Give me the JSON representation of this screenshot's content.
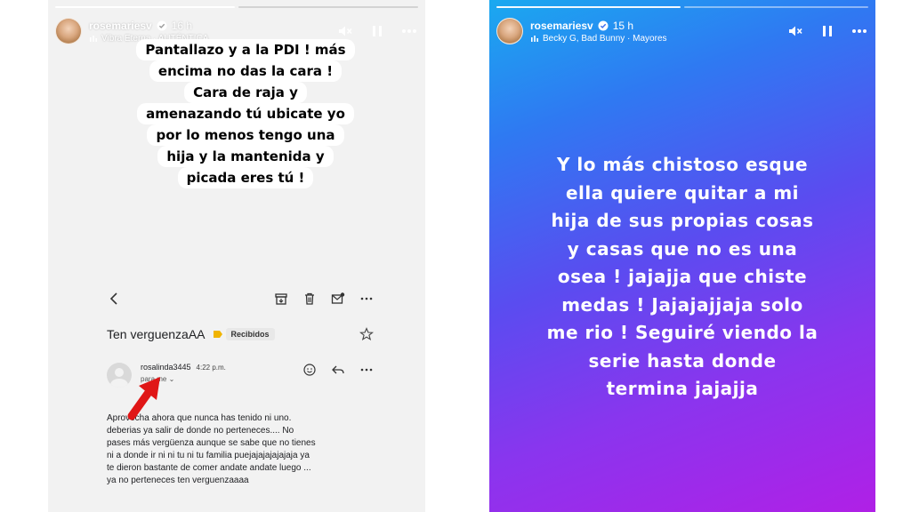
{
  "left_story": {
    "progress": {
      "segments": 2,
      "completed": 1
    },
    "username": "rosemariesv",
    "time": "16 h",
    "music": "Vibra Eterna · AUTÉNTICA",
    "caption_lines": [
      "Pantallazo y a la PDI ! más",
      "encima no das la cara !",
      "Cara de raja y",
      "amenazando tú ubicate yo",
      "por lo menos tengo una",
      "hija y la mantenida y",
      "picada eres tú !"
    ],
    "email": {
      "subject": "Ten verguenzaAA",
      "label": "Recibidos",
      "sender": "rosalinda3445",
      "sent_time": "4:22 p.m.",
      "recipient": "para me",
      "body_lines": [
        "Aprovecha ahora que nunca has tenido ni uno.",
        "deberias ya salir de donde no perteneces.... No",
        "pases más vergüenza aunque se sabe que no tienes",
        "ni a donde ir ni ni tu ni tu familia puejajajajajajaja ya",
        "te dieron bastante de comer andate andate luego ...",
        "ya no perteneces ten verguenzaaaa"
      ]
    }
  },
  "right_story": {
    "progress": {
      "segments": 2,
      "completed": 1
    },
    "username": "rosemariesv",
    "time": "15 h",
    "music": "Becky G, Bad Bunny · Mayores",
    "caption_lines": [
      "Y lo más chistoso esque",
      "ella quiere quitar a mi",
      "hija de sus propias cosas",
      "y casas que no es una",
      "osea !  jajajja que chiste",
      "medas ! Jajajajjaja solo",
      "me rio ! Seguiré viendo la",
      "serie hasta donde",
      "termina jajajja"
    ]
  },
  "colors": {
    "left_bg": "#f2f2f2",
    "right_gradient": [
      "#1aa9f0",
      "#5a4cf0",
      "#b020e6"
    ],
    "arrow": "#e01616",
    "verified": "#3897f0"
  },
  "icons": [
    "verified-badge-icon",
    "music-bars-icon",
    "mute-icon",
    "pause-icon",
    "more-icon",
    "back-arrow-icon",
    "archive-icon",
    "trash-icon",
    "mark-unread-icon",
    "label-arrow-icon",
    "star-icon",
    "emoji-icon",
    "reply-icon",
    "red-arrow-icon"
  ]
}
